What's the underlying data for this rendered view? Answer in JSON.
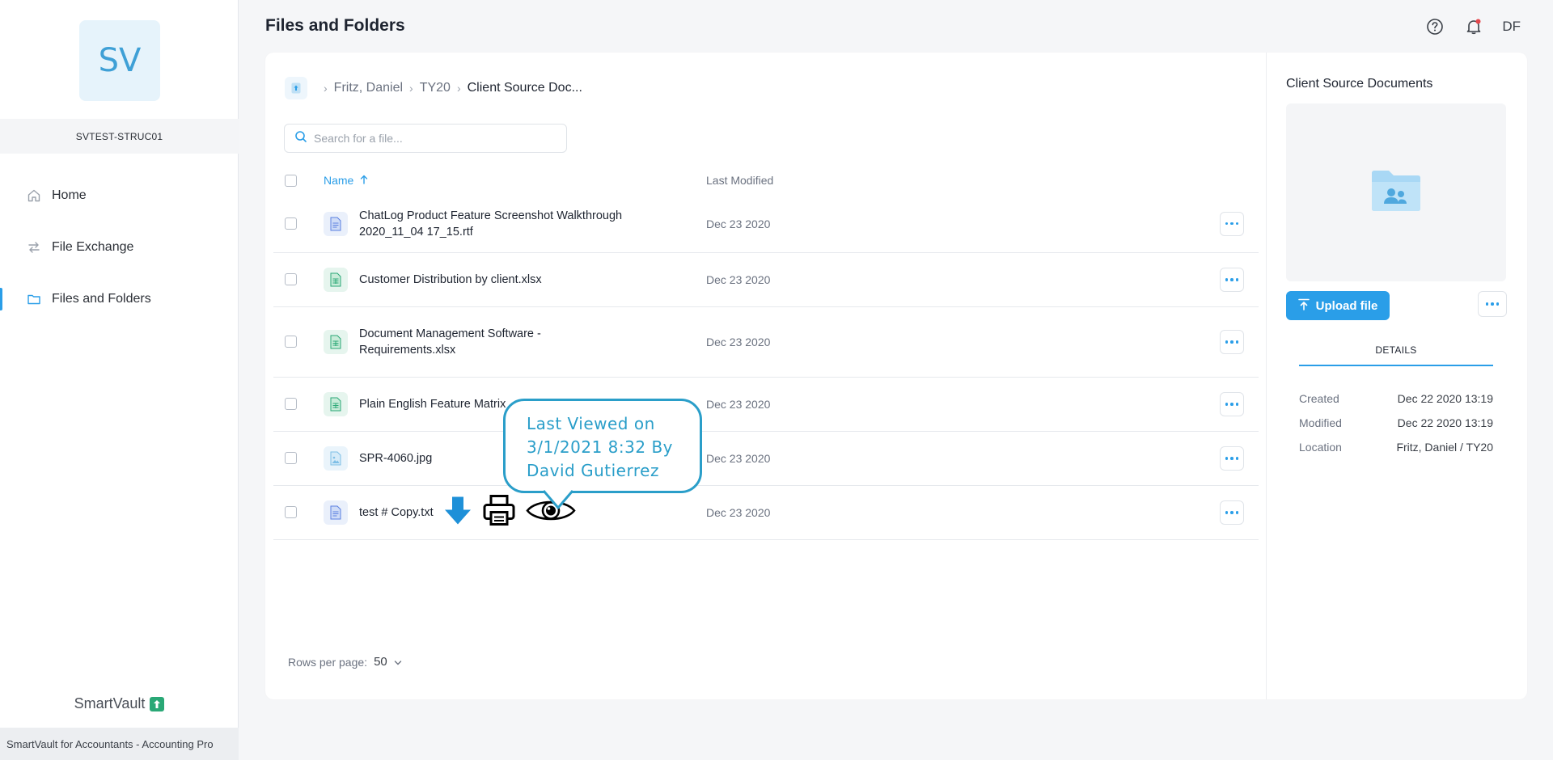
{
  "sidebar": {
    "avatar_initials": "SV",
    "account_name": "SVTEST-STRUC01",
    "items": [
      {
        "label": "Home",
        "icon": "home-icon"
      },
      {
        "label": "File Exchange",
        "icon": "exchange-icon"
      },
      {
        "label": "Files and Folders",
        "icon": "folder-icon",
        "active": true
      }
    ],
    "brand": "SmartVault",
    "footer": "SmartVault for Accountants - Accounting Pro"
  },
  "header": {
    "title": "Files and Folders",
    "user_initials": "DF"
  },
  "breadcrumb": {
    "items": [
      "Fritz, Daniel",
      "TY20"
    ],
    "current": "Client Source Doc..."
  },
  "search": {
    "placeholder": "Search for a file..."
  },
  "table": {
    "col_name": "Name",
    "col_modified": "Last Modified",
    "rows": [
      {
        "name": "ChatLog Product Feature Screenshot Walkthrough 2020_11_04 17_15.rtf",
        "modified": "Dec 23 2020",
        "type": "doc"
      },
      {
        "name": "Customer Distribution by client.xlsx",
        "modified": "Dec 23 2020",
        "type": "sheet"
      },
      {
        "name": "Document Management Software - Requirements.xlsx",
        "modified": "Dec 23 2020",
        "type": "sheet"
      },
      {
        "name": "Plain English Feature Matrix",
        "modified": "Dec 23 2020",
        "type": "sheet"
      },
      {
        "name": "SPR-4060.jpg",
        "modified": "Dec 23 2020",
        "type": "image"
      },
      {
        "name": "test # Copy.txt",
        "modified": "Dec 23 2020",
        "type": "doc"
      }
    ]
  },
  "tooltip": {
    "line1": "Last Viewed on",
    "line2": "3/1/2021 8:32 By",
    "line3": "David Gutierrez"
  },
  "pagination": {
    "label": "Rows per page:",
    "value": "50"
  },
  "details": {
    "title": "Client Source Documents",
    "upload_label": "Upload file",
    "tab_label": "DETAILS",
    "meta": [
      {
        "key": "Created",
        "value": "Dec 22 2020 13:19"
      },
      {
        "key": "Modified",
        "value": "Dec 22 2020 13:19"
      },
      {
        "key": "Location",
        "value": "Fritz, Daniel / TY20"
      }
    ]
  },
  "colors": {
    "accent": "#2a9ee8",
    "tooltip": "#2a9ec9",
    "sheet_icon": "#2aa876",
    "doc_icon": "#5b7fe0"
  }
}
